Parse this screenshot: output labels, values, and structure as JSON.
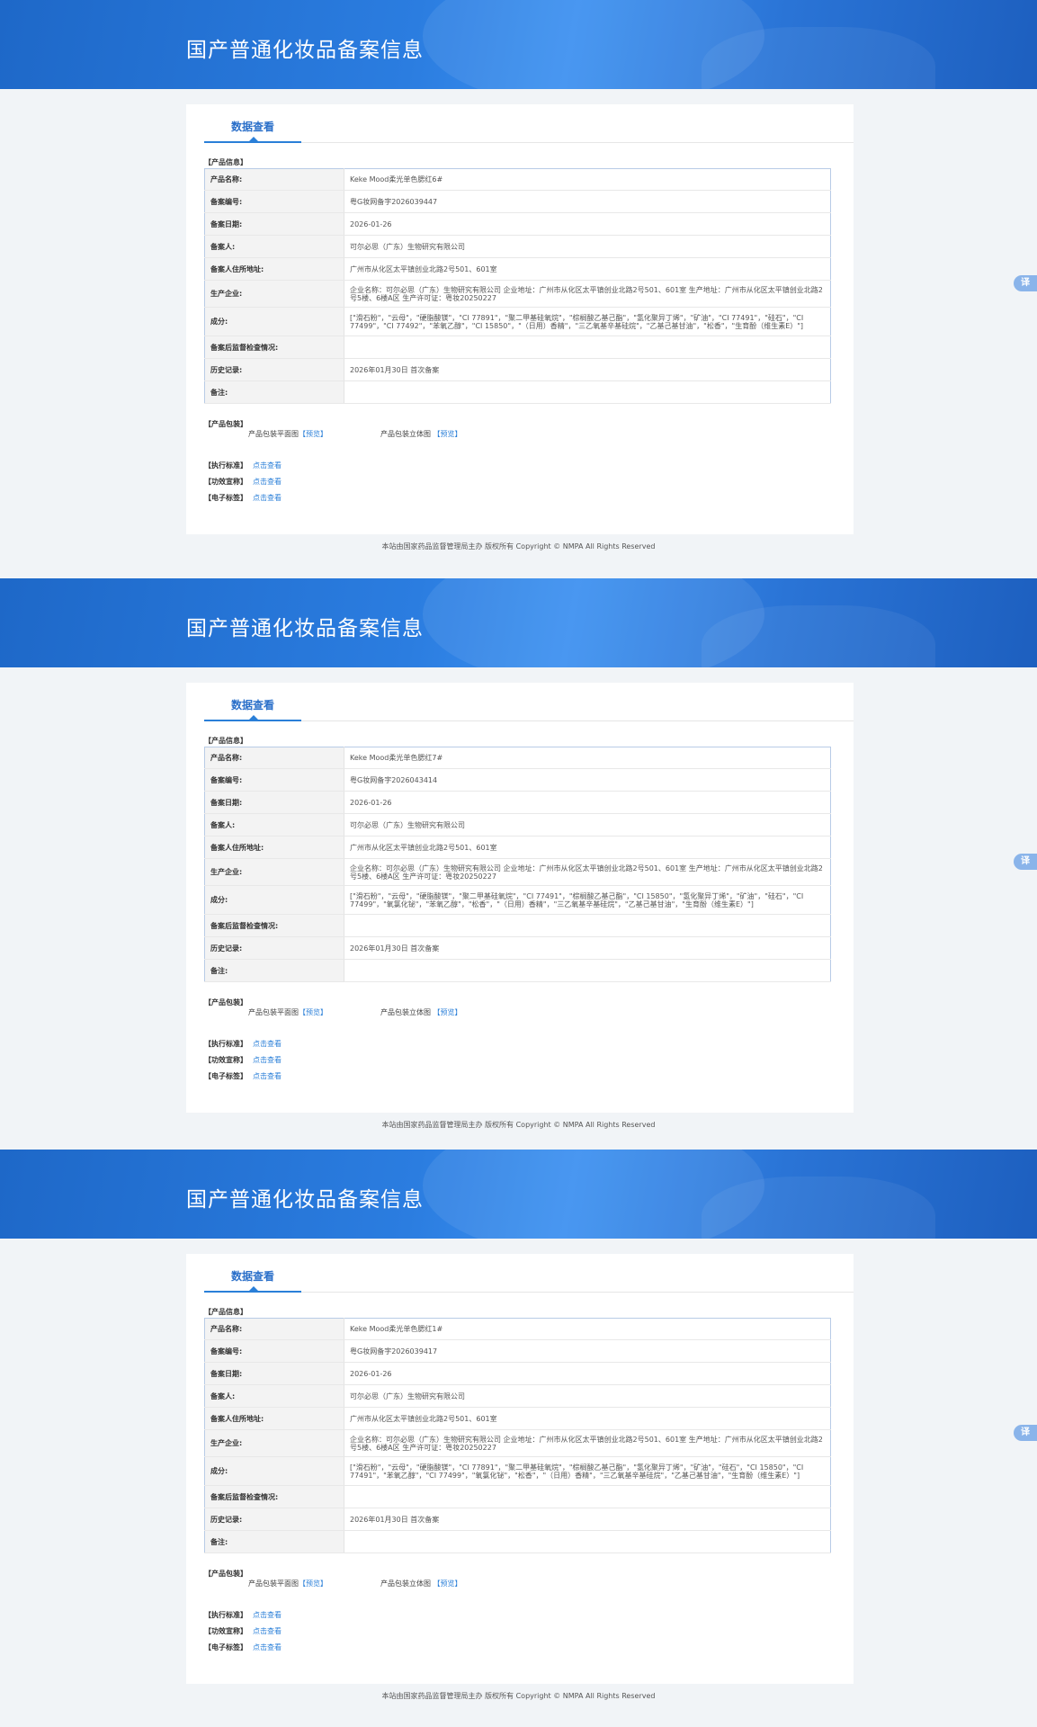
{
  "side_tab_label": "译",
  "footer_text": "本站由国家药品监督管理局主办 版权所有 Copyright © NMPA All Rights Reserved",
  "records": [
    {
      "banner_title": "国产普通化妆品备案信息",
      "tab_label": "数据查看",
      "product_section": "【产品信息】",
      "fields": [
        {
          "key": "产品名称:",
          "value": "Keke Mood柔光单色腮红6#"
        },
        {
          "key": "备案编号:",
          "value": "粤G妆网备字2026039447"
        },
        {
          "key": "备案日期:",
          "value": "2026-01-26"
        },
        {
          "key": "备案人:",
          "value": "可尔必思（广东）生物研究有限公司"
        },
        {
          "key": "备案人住所地址:",
          "value": "广州市从化区太平镇创业北路2号501、601室"
        },
        {
          "key": "生产企业:",
          "value": "企业名称：可尔必思（广东）生物研究有限公司 企业地址：广州市从化区太平镇创业北路2号501、601室 生产地址：广州市从化区太平镇创业北路2号5楼、6楼A区 生产许可证：粤妆20250227"
        },
        {
          "key": "成分:",
          "value": "[\"滑石粉\"，\"云母\"，\"硬脂酸镁\"，\"CI 77891\"，\"聚二甲基硅氧烷\"，\"棕榈酸乙基己酯\"，\"氢化聚异丁烯\"，\"矿油\"，\"CI 77491\"，\"硅石\"，\"CI 77499\"，\"CI 77492\"，\"苯氧乙醇\"，\"CI 15850\"，\"（日用）香精\"，\"三乙氧基辛基硅烷\"，\"乙基己基甘油\"，\"松香\"，\"生育酚（维生素E）\"]"
        },
        {
          "key": "备案后监督检查情况:",
          "value": ""
        },
        {
          "key": "历史记录:",
          "value": "2026年01月30日 首次备案"
        },
        {
          "key": "备注:",
          "value": ""
        }
      ],
      "package_section": "【产品包装】",
      "package_flat": "产品包装平面图",
      "package_3d": "产品包装立体图",
      "preview_link": "【预览】",
      "standards": [
        {
          "label": "【执行标准】",
          "link": "点击查看"
        },
        {
          "label": "【功效宣称】",
          "link": "点击查看"
        },
        {
          "label": "【电子标签】",
          "link": "点击查看"
        }
      ]
    },
    {
      "banner_title": "国产普通化妆品备案信息",
      "tab_label": "数据查看",
      "product_section": "【产品信息】",
      "fields": [
        {
          "key": "产品名称:",
          "value": "Keke Mood柔光单色腮红7#"
        },
        {
          "key": "备案编号:",
          "value": "粤G妆网备字2026043414"
        },
        {
          "key": "备案日期:",
          "value": "2026-01-26"
        },
        {
          "key": "备案人:",
          "value": "可尔必思（广东）生物研究有限公司"
        },
        {
          "key": "备案人住所地址:",
          "value": "广州市从化区太平镇创业北路2号501、601室"
        },
        {
          "key": "生产企业:",
          "value": "企业名称：可尔必思（广东）生物研究有限公司 企业地址：广州市从化区太平镇创业北路2号501、601室 生产地址：广州市从化区太平镇创业北路2号5楼、6楼A区 生产许可证：粤妆20250227"
        },
        {
          "key": "成分:",
          "value": "[\"滑石粉\"，\"云母\"，\"硬脂酸镁\"，\"聚二甲基硅氧烷\"，\"CI 77491\"，\"棕榈酸乙基己酯\"，\"CI 15850\"，\"氢化聚异丁烯\"，\"矿油\"，\"硅石\"，\"CI 77499\"，\"氧氯化铋\"，\"苯氧乙醇\"，\"松香\"，\"（日用）香精\"，\"三乙氧基辛基硅烷\"，\"乙基己基甘油\"，\"生育酚（维生素E）\"]"
        },
        {
          "key": "备案后监督检查情况:",
          "value": ""
        },
        {
          "key": "历史记录:",
          "value": "2026年01月30日 首次备案"
        },
        {
          "key": "备注:",
          "value": ""
        }
      ],
      "package_section": "【产品包装】",
      "package_flat": "产品包装平面图",
      "package_3d": "产品包装立体图",
      "preview_link": "【预览】",
      "standards": [
        {
          "label": "【执行标准】",
          "link": "点击查看"
        },
        {
          "label": "【功效宣称】",
          "link": "点击查看"
        },
        {
          "label": "【电子标签】",
          "link": "点击查看"
        }
      ]
    },
    {
      "banner_title": "国产普通化妆品备案信息",
      "tab_label": "数据查看",
      "product_section": "【产品信息】",
      "fields": [
        {
          "key": "产品名称:",
          "value": "Keke Mood柔光单色腮红1#"
        },
        {
          "key": "备案编号:",
          "value": "粤G妆网备字2026039417"
        },
        {
          "key": "备案日期:",
          "value": "2026-01-26"
        },
        {
          "key": "备案人:",
          "value": "可尔必思（广东）生物研究有限公司"
        },
        {
          "key": "备案人住所地址:",
          "value": "广州市从化区太平镇创业北路2号501、601室"
        },
        {
          "key": "生产企业:",
          "value": "企业名称：可尔必思（广东）生物研究有限公司 企业地址：广州市从化区太平镇创业北路2号501、601室 生产地址：广州市从化区太平镇创业北路2号5楼、6楼A区 生产许可证：粤妆20250227"
        },
        {
          "key": "成分:",
          "value": "[\"滑石粉\"，\"云母\"，\"硬脂酸镁\"，\"CI 77891\"，\"聚二甲基硅氧烷\"，\"棕榈酸乙基己酯\"，\"氢化聚异丁烯\"，\"矿油\"，\"硅石\"，\"CI 15850\"，\"CI 77491\"，\"苯氧乙醇\"，\"CI 77499\"，\"氧氯化铋\"，\"松香\"，\"（日用）香精\"，\"三乙氧基辛基硅烷\"，\"乙基己基甘油\"，\"生育酚（维生素E）\"]"
        },
        {
          "key": "备案后监督检查情况:",
          "value": ""
        },
        {
          "key": "历史记录:",
          "value": "2026年01月30日 首次备案"
        },
        {
          "key": "备注:",
          "value": ""
        }
      ],
      "package_section": "【产品包装】",
      "package_flat": "产品包装平面图",
      "package_3d": "产品包装立体图",
      "preview_link": "【预览】",
      "standards": [
        {
          "label": "【执行标准】",
          "link": "点击查看"
        },
        {
          "label": "【功效宣称】",
          "link": "点击查看"
        },
        {
          "label": "【电子标签】",
          "link": "点击查看"
        }
      ]
    }
  ]
}
